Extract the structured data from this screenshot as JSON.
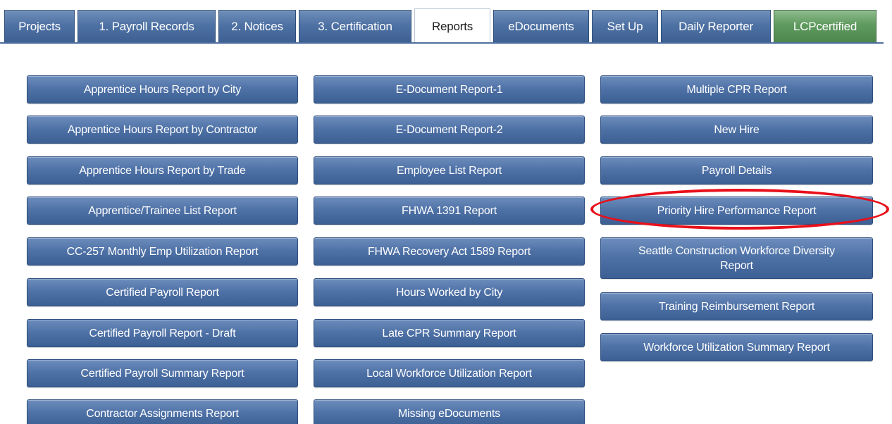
{
  "tabs": [
    {
      "label": "Projects",
      "name": "tab-projects",
      "active": false,
      "variant": "blue"
    },
    {
      "label": "1. Payroll Records",
      "name": "tab-payroll-records",
      "active": false,
      "variant": "blue"
    },
    {
      "label": "2. Notices",
      "name": "tab-notices",
      "active": false,
      "variant": "blue"
    },
    {
      "label": "3. Certification",
      "name": "tab-certification",
      "active": false,
      "variant": "blue"
    },
    {
      "label": "Reports",
      "name": "tab-reports",
      "active": true,
      "variant": "blue"
    },
    {
      "label": "eDocuments",
      "name": "tab-edocuments",
      "active": false,
      "variant": "blue"
    },
    {
      "label": "Set Up",
      "name": "tab-set-up",
      "active": false,
      "variant": "blue"
    },
    {
      "label": "Daily Reporter",
      "name": "tab-daily-reporter",
      "active": false,
      "variant": "blue"
    },
    {
      "label": "LCPcertified",
      "name": "tab-lcpcertified",
      "active": false,
      "variant": "green"
    }
  ],
  "reports": {
    "column1": [
      {
        "label": "Apprentice Hours Report by City",
        "name": "report-apprentice-hours-by-city"
      },
      {
        "label": "Apprentice Hours Report by Contractor",
        "name": "report-apprentice-hours-by-contractor"
      },
      {
        "label": "Apprentice Hours Report by Trade",
        "name": "report-apprentice-hours-by-trade"
      },
      {
        "label": "Apprentice/Trainee List Report",
        "name": "report-apprentice-trainee-list"
      },
      {
        "label": "CC-257 Monthly Emp Utilization Report",
        "name": "report-cc257-monthly-emp-utilization"
      },
      {
        "label": "Certified Payroll Report",
        "name": "report-certified-payroll"
      },
      {
        "label": "Certified Payroll Report - Draft",
        "name": "report-certified-payroll-draft"
      },
      {
        "label": "Certified Payroll Summary Report",
        "name": "report-certified-payroll-summary"
      },
      {
        "label": "Contractor Assignments Report",
        "name": "report-contractor-assignments"
      }
    ],
    "column2": [
      {
        "label": "E-Document Report-1",
        "name": "report-edocument-1"
      },
      {
        "label": "E-Document Report-2",
        "name": "report-edocument-2"
      },
      {
        "label": "Employee List Report",
        "name": "report-employee-list"
      },
      {
        "label": "FHWA 1391 Report",
        "name": "report-fhwa-1391"
      },
      {
        "label": "FHWA Recovery Act 1589 Report",
        "name": "report-fhwa-recovery-act-1589"
      },
      {
        "label": "Hours Worked by City",
        "name": "report-hours-worked-by-city"
      },
      {
        "label": "Late CPR Summary Report",
        "name": "report-late-cpr-summary"
      },
      {
        "label": "Local Workforce Utilization Report",
        "name": "report-local-workforce-utilization"
      },
      {
        "label": "Missing eDocuments",
        "name": "report-missing-edocuments"
      }
    ],
    "column3": [
      {
        "label": "Multiple CPR Report",
        "name": "report-multiple-cpr"
      },
      {
        "label": "New Hire",
        "name": "report-new-hire"
      },
      {
        "label": "Payroll Details",
        "name": "report-payroll-details"
      },
      {
        "label": "Priority Hire Performance Report",
        "name": "report-priority-hire-performance",
        "highlighted": true
      },
      {
        "label": "Seattle Construction Workforce Diversity Report",
        "name": "report-seattle-construction-workforce-diversity"
      },
      {
        "label": "Training Reimbursement Report",
        "name": "report-training-reimbursement"
      },
      {
        "label": "Workforce Utilization Summary Report",
        "name": "report-workforce-utilization-summary"
      }
    ]
  },
  "colors": {
    "tab_blue": "#4f72a4",
    "tab_green": "#5f9a5f",
    "button_blue": "#4d70a5",
    "highlight_oval": "#e8101a",
    "tab_underline": "#4e6f9f"
  }
}
